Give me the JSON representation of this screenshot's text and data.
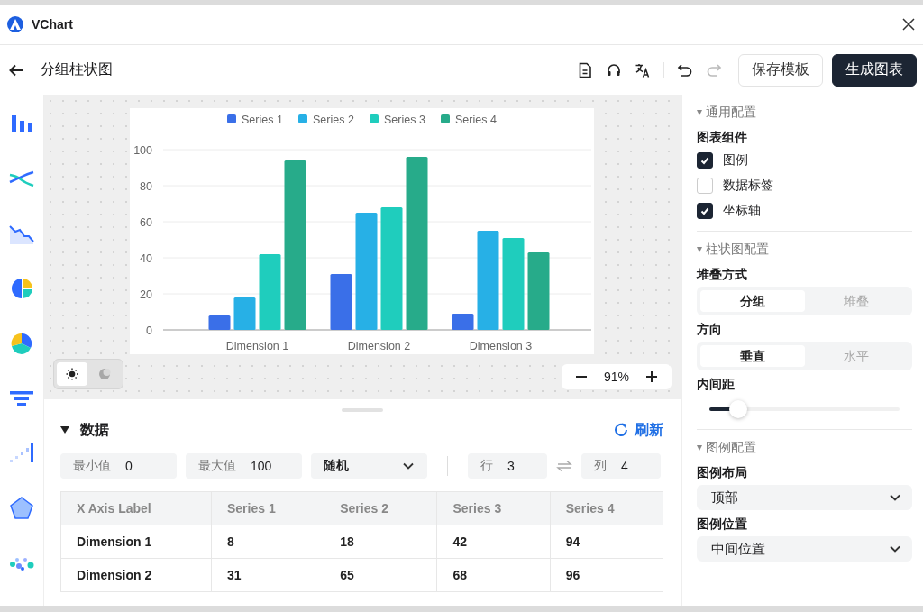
{
  "window": {
    "title": "VChart"
  },
  "toolbar": {
    "title": "分组柱状图",
    "buttons": [
      {
        "label": "保存模板",
        "kind": "secondary"
      },
      {
        "label": "生成图表",
        "kind": "primary"
      }
    ]
  },
  "chart": {
    "chart_data": {
      "type": "bar",
      "grid": true,
      "legend": true,
      "categories": [
        "Dimension 1",
        "Dimension 2",
        "Dimension 3"
      ],
      "ylim": [
        0,
        100
      ],
      "yticks": [
        0,
        20,
        40,
        60,
        80,
        100
      ],
      "series": [
        {
          "name": "Series 1",
          "color": "#3a6fe8",
          "values": [
            8,
            31,
            9
          ]
        },
        {
          "name": "Series 2",
          "color": "#27b0e6",
          "values": [
            18,
            65,
            55
          ]
        },
        {
          "name": "Series 3",
          "color": "#1fcdbd",
          "values": [
            42,
            68,
            51
          ]
        },
        {
          "name": "Series 4",
          "color": "#27ab8a",
          "values": [
            94,
            96,
            43
          ]
        }
      ]
    }
  },
  "theme_toggle": [
    {
      "kind": "light",
      "selected": true
    },
    {
      "kind": "dark",
      "selected": false
    }
  ],
  "zoom": {
    "value": "91%"
  },
  "data_panel": {
    "title": "数据",
    "expanded": true,
    "refresh": "刷新",
    "min": {
      "label": "最小值",
      "value": "0"
    },
    "max": {
      "label": "最大值",
      "value": "100"
    },
    "mode": "随机",
    "rows": {
      "label": "行",
      "value": "3"
    },
    "cols": {
      "label": "列",
      "value": "4"
    },
    "table": {
      "columns": [
        "X Axis Label",
        "Series 1",
        "Series 2",
        "Series 3",
        "Series 4"
      ],
      "rows": [
        [
          "Dimension 1",
          "8",
          "18",
          "42",
          "94"
        ],
        [
          "Dimension 2",
          "31",
          "65",
          "68",
          "96"
        ]
      ]
    }
  },
  "settings": [
    {
      "title": "通用配置",
      "expanded": true,
      "items": [
        {
          "kind": "checkgroup",
          "label": "图表组件",
          "options": [
            {
              "label": "图例",
              "checked": true
            },
            {
              "label": "数据标签",
              "checked": false
            },
            {
              "label": "坐标轴",
              "checked": true
            }
          ]
        }
      ]
    },
    {
      "title": "柱状图配置",
      "expanded": true,
      "items": [
        {
          "kind": "segmented",
          "label": "堆叠方式",
          "options": [
            {
              "label": "分组",
              "selected": true
            },
            {
              "label": "堆叠",
              "selected": false
            }
          ]
        },
        {
          "kind": "segmented",
          "label": "方向",
          "options": [
            {
              "label": "垂直",
              "selected": true
            },
            {
              "label": "水平",
              "selected": false
            }
          ]
        },
        {
          "kind": "slider",
          "label": "内间距",
          "level": 0.15
        }
      ]
    },
    {
      "title": "图例配置",
      "expanded": true,
      "items": [
        {
          "kind": "select",
          "label": "图例布局",
          "value": "顶部"
        },
        {
          "kind": "select",
          "label": "图例位置",
          "value": "中间位置"
        }
      ]
    }
  ]
}
